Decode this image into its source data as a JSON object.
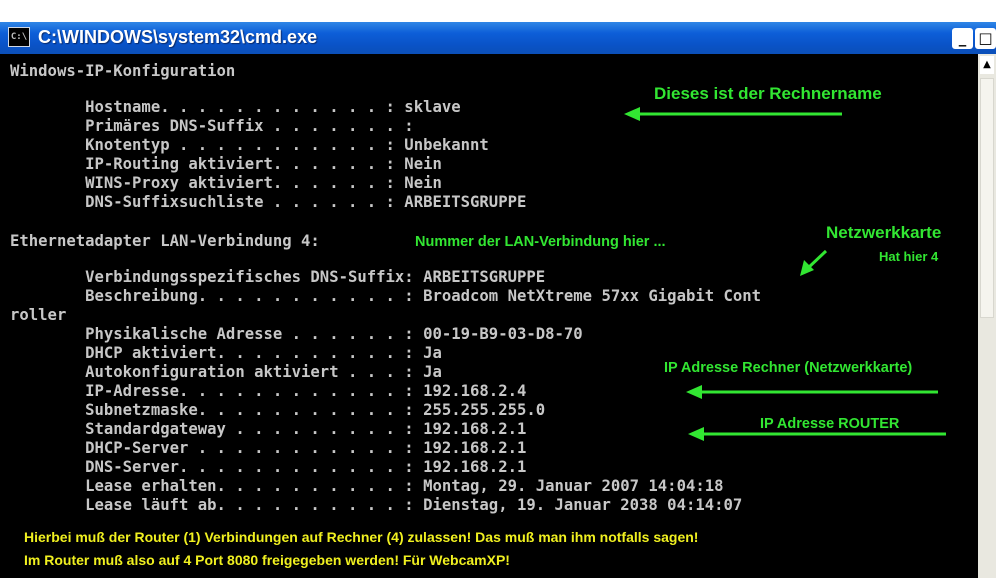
{
  "window": {
    "title": "C:\\WINDOWS\\system32\\cmd.exe",
    "icon_label": "C:\\",
    "buttons": {
      "minimize": "_",
      "maximize": "□",
      "close": "×"
    }
  },
  "console": {
    "lines": [
      "Windows-IP-Konfiguration",
      "        Hostname. . . . . . . . . . . . : sklave",
      "        Primäres DNS-Suffix . . . . . . . :",
      "        Knotentyp . . . . . . . . . . . : Unbekannt",
      "        IP-Routing aktiviert. . . . . . : Nein",
      "        WINS-Proxy aktiviert. . . . . . : Nein",
      "        DNS-Suffixsuchliste . . . . . . : ARBEITSGRUPPE",
      "Ethernetadapter LAN-Verbindung 4:",
      "        Verbindungsspezifisches DNS-Suffix: ARBEITSGRUPPE",
      "        Beschreibung. . . . . . . . . . . : Broadcom NetXtreme 57xx Gigabit Cont",
      "roller",
      "        Physikalische Adresse . . . . . . : 00-19-B9-03-D8-70",
      "        DHCP aktiviert. . . . . . . . . . : Ja",
      "        Autokonfiguration aktiviert . . . : Ja",
      "        IP-Adresse. . . . . . . . . . . . : 192.168.2.4",
      "        Subnetzmaske. . . . . . . . . . . : 255.255.255.0",
      "        Standardgateway . . . . . . . . . : 192.168.2.1",
      "        DHCP-Server . . . . . . . . . . . : 192.168.2.1",
      "        DNS-Server. . . . . . . . . . . . : 192.168.2.1",
      "        Lease erhalten. . . . . . . . . . : Montag, 29. Januar 2007 14:04:18",
      "        Lease läuft ab. . . . . . . . . . : Dienstag, 19. Januar 2038 04:14:07"
    ]
  },
  "annotations": {
    "rechnername": "Dieses ist der Rechnername",
    "lan_nummer": "Nummer der LAN-Verbindung hier ...",
    "netzwerkkarte": "Netzwerkkarte",
    "hat_hier": "Hat hier 4",
    "ip_rechner": "IP Adresse Rechner (Netzwerkkarte)",
    "ip_router": "IP Adresse ROUTER",
    "bottom_1": "Hierbei muß der Router (1) Verbindungen auf  Rechner (4) zulassen! Das muß man ihm notfalls sagen!",
    "bottom_2": "Im Router muß also auf 4 Port 8080 freigegeben werden! Für WebcamXP!"
  },
  "colors": {
    "console_bg": "#000000",
    "console_text": "#c7c7c7",
    "annotation_green": "#32e632",
    "annotation_yellow": "#f0f020",
    "titlebar_blue": "#0a53c8"
  }
}
